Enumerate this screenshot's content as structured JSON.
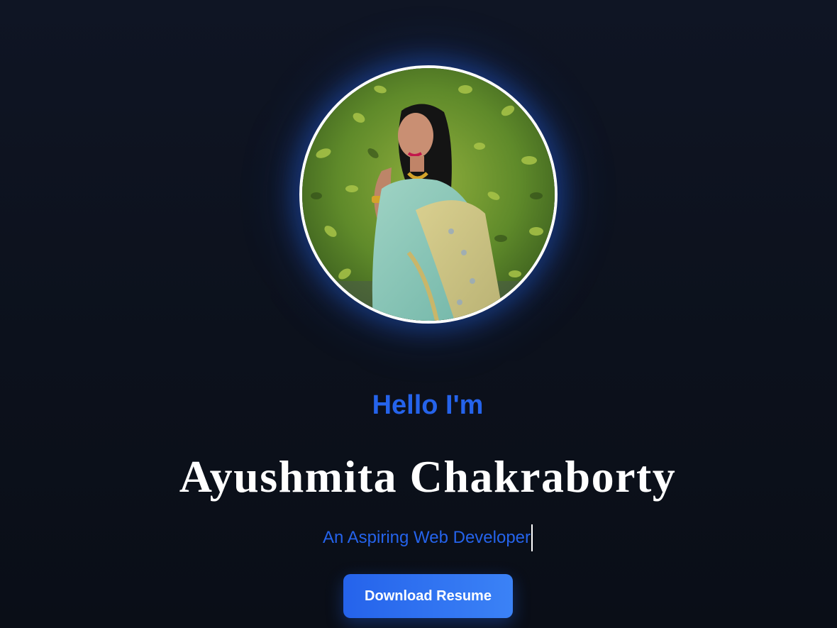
{
  "hero": {
    "greeting": "Hello I'm",
    "name": "Ayushmita Chakraborty",
    "tagline": "An Aspiring Web Developer",
    "download_label": "Download Resume",
    "profile_image_alt": "Ayushmita Chakraborty"
  },
  "colors": {
    "background": "#0c111c",
    "accent": "#2563eb",
    "accent_light": "#3b82f6",
    "text": "#ffffff",
    "avatar_border": "#ffffff"
  },
  "icons": {
    "text_caret": "typing-cursor"
  }
}
